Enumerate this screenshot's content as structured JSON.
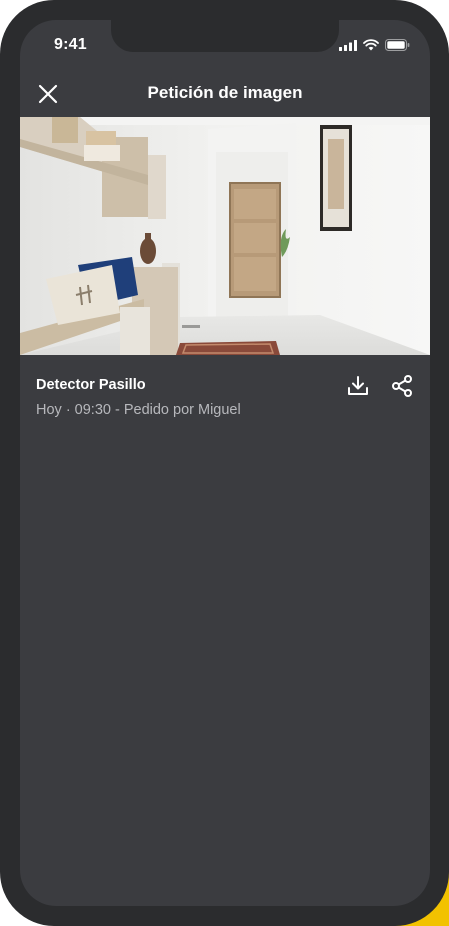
{
  "status_bar": {
    "time": "9:41",
    "icons": [
      "signal-icon",
      "wifi-icon",
      "battery-icon"
    ]
  },
  "header": {
    "title": "Petición de imagen",
    "close_icon": "close-icon"
  },
  "photo": {
    "subject": "hallway-camera-snapshot"
  },
  "detail": {
    "device_name": "Detector Pasillo",
    "meta": "Hoy · 09:30 - Pedido por Miguel"
  },
  "actions": {
    "download_icon": "download-icon",
    "share_icon": "share-icon"
  },
  "colors": {
    "screen_bg": "#3b3c40",
    "frame": "#2b2c2e",
    "text_primary": "#ffffff",
    "text_secondary": "#b7b8bc",
    "accent": "#f2c200"
  }
}
